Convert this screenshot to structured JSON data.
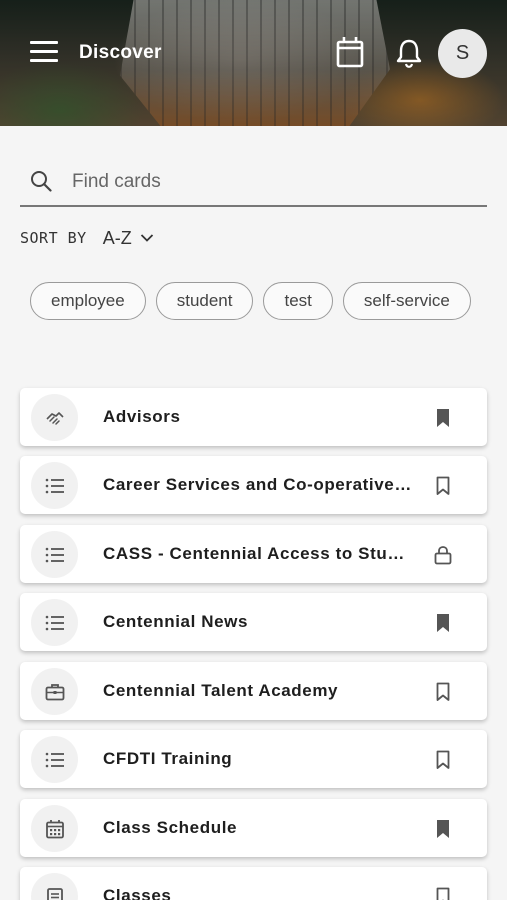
{
  "header": {
    "title": "Discover",
    "avatar_initial": "S"
  },
  "search": {
    "placeholder": "Find cards",
    "value": ""
  },
  "sort": {
    "label": "SORT BY",
    "value": "A-Z"
  },
  "tags": [
    "employee",
    "student",
    "test",
    "self-service"
  ],
  "cards": [
    {
      "name": "Advisors",
      "icon": "handshake-icon",
      "action": "bookmark-filled"
    },
    {
      "name": "Career Services and Co-operative Education",
      "icon": "list-icon",
      "action": "bookmark-outline"
    },
    {
      "name": "CASS - Centennial Access to Student Services",
      "icon": "list-icon",
      "action": "lock"
    },
    {
      "name": "Centennial News",
      "icon": "list-icon",
      "action": "bookmark-filled"
    },
    {
      "name": "Centennial Talent Academy",
      "icon": "briefcase-icon",
      "action": "bookmark-outline"
    },
    {
      "name": "CFDTI Training",
      "icon": "list-icon",
      "action": "bookmark-outline"
    },
    {
      "name": "Class Schedule",
      "icon": "calendar-icon",
      "action": "bookmark-filled"
    },
    {
      "name": "Classes",
      "icon": "document-icon",
      "action": "bookmark-outline"
    }
  ],
  "colors": {
    "icon": "#555555",
    "card_bg": "#ffffff",
    "page_bg": "#f5f5f5"
  }
}
